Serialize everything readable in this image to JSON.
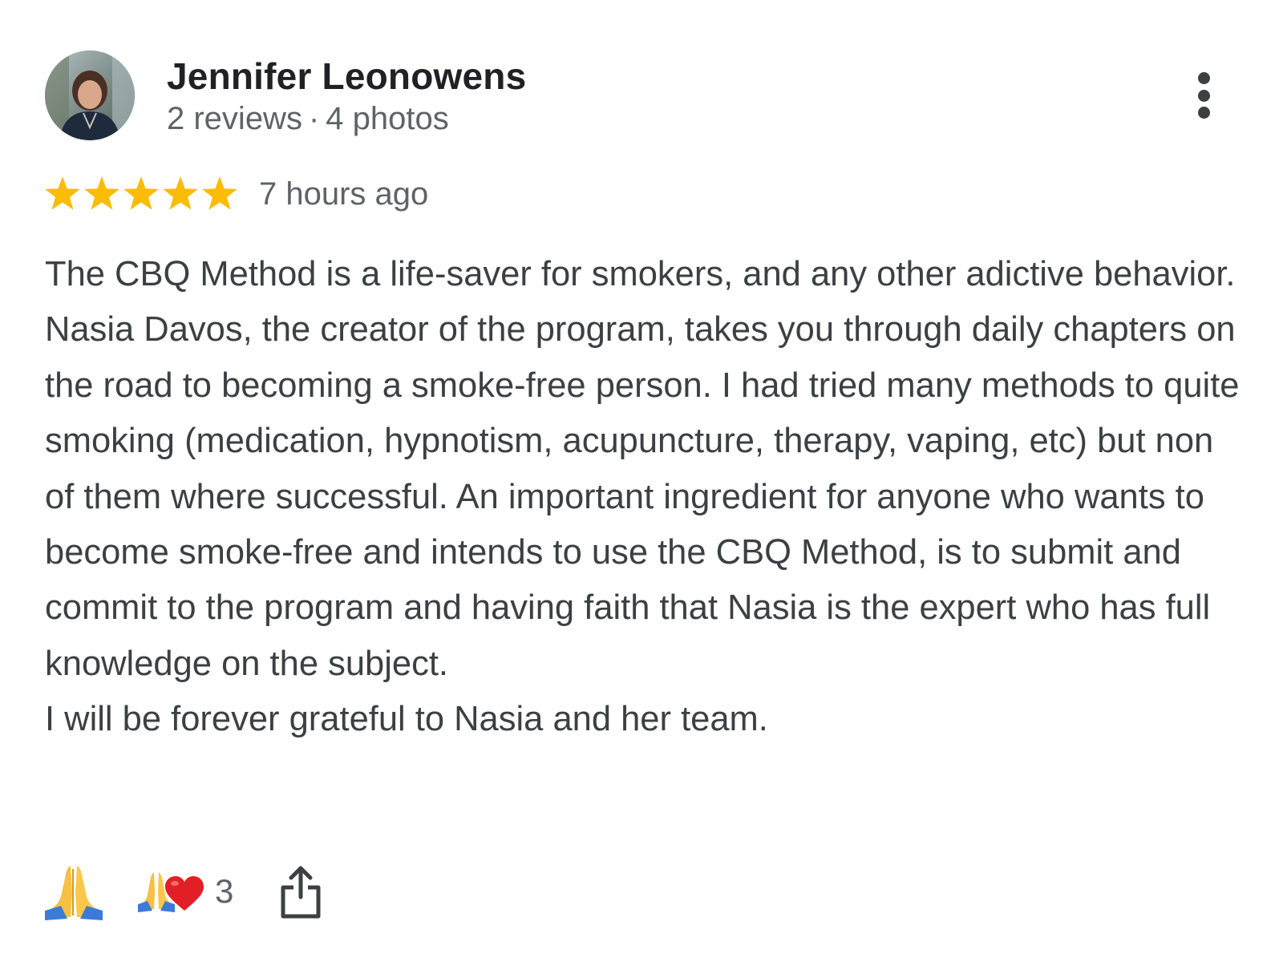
{
  "author": {
    "name": "Jennifer Leonowens",
    "reviews": "2 reviews",
    "separator": "·",
    "photos": "4 photos"
  },
  "review": {
    "rating": 5,
    "max_rating": 5,
    "star_color": "#fbbc04",
    "time": "7 hours ago",
    "text": "The CBQ Method is a life-saver for smokers, and any other adictive behavior. Nasia Davos, the creator of the program, takes you through daily chapters on the road to becoming a smoke-free person. I had tried many methods to quite smoking (medication, hypnotism, acupuncture, therapy, vaping, etc) but non of them where successful. An important ingredient for anyone who wants to become smoke-free and intends to use the CBQ Method, is to submit and commit to the program and having faith that Nasia is the expert who has full knowledge on the subject.\nI will be forever grateful to Nasia and her team."
  },
  "reactions": {
    "add_reaction_icon": "folded-hands-emoji",
    "summary_icons": [
      "folded-hands-emoji",
      "red-heart-emoji"
    ],
    "count": "3"
  },
  "actions": {
    "more_icon": "more-vert-icon",
    "share_icon": "share-icon"
  }
}
